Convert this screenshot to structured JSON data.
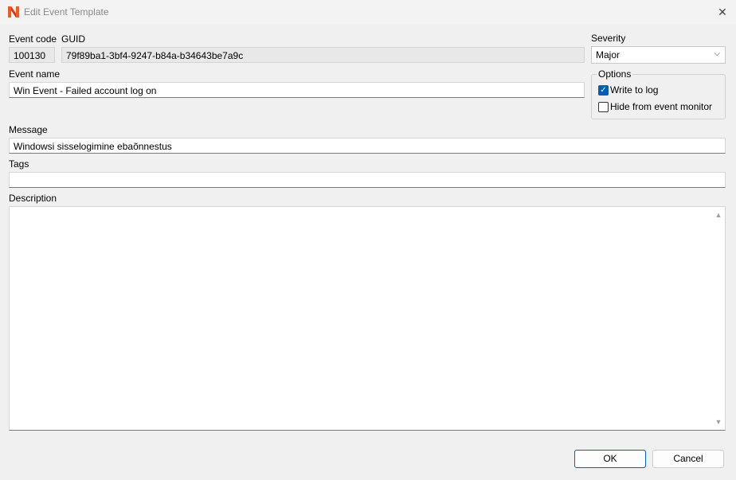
{
  "window": {
    "title": "Edit Event Template",
    "close_glyph": "✕",
    "icon": "app-logo-icon"
  },
  "form": {
    "event_code": {
      "label": "Event code",
      "value": "100130"
    },
    "guid": {
      "label": "GUID",
      "value": "79f89ba1-3bf4-9247-b84a-b34643be7a9c"
    },
    "severity": {
      "label": "Severity",
      "value": "Major",
      "chevron": "⌵"
    },
    "event_name": {
      "label": "Event name",
      "value": "Win Event - Failed account log on"
    },
    "options": {
      "label": "Options",
      "write_to_log": {
        "label": "Write to log",
        "checked": true
      },
      "hide_from_monitor": {
        "label": "Hide from event monitor",
        "checked": false
      }
    },
    "message": {
      "label": "Message",
      "value": "Windowsi sisselogimine ebaõnnestus"
    },
    "tags": {
      "label": "Tags",
      "value": ""
    },
    "description": {
      "label": "Description",
      "value": ""
    }
  },
  "buttons": {
    "ok": "OK",
    "cancel": "Cancel"
  },
  "colors": {
    "accent": "#005fb8",
    "logo_orange": "#f25a1e",
    "logo_red": "#e0301e"
  }
}
